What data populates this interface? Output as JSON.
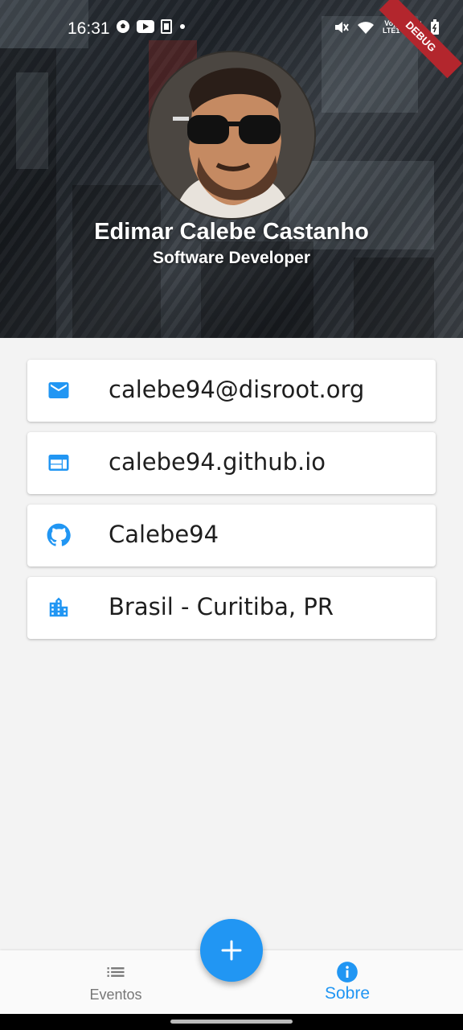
{
  "status_bar": {
    "time": "16:31",
    "left_icons": [
      "soccer-ball-icon",
      "youtube-icon",
      "sim-icon",
      "dot-icon"
    ],
    "right_icons": [
      "mute-icon",
      "wifi-icon",
      "volte-icon",
      "signal-icon",
      "battery-icon"
    ],
    "volte_label_top": "Vo))",
    "volte_label_bottom": "LTE1",
    "debug_banner": "DEBUG"
  },
  "profile": {
    "name": "Edimar Calebe Castanho",
    "role": "Software Developer"
  },
  "contacts": [
    {
      "icon": "email-icon",
      "label": "calebe94@disroot.org"
    },
    {
      "icon": "web-icon",
      "label": "calebe94.github.io"
    },
    {
      "icon": "github-icon",
      "label": "Calebe94"
    },
    {
      "icon": "location-city-icon",
      "label": "Brasil - Curitiba, PR"
    }
  ],
  "bottom_nav": {
    "items": [
      {
        "icon": "list-icon",
        "label": "Eventos",
        "active": false
      },
      {
        "icon": "info-icon",
        "label": "Sobre",
        "active": true
      }
    ]
  },
  "fab": {
    "icon": "plus-icon"
  },
  "colors": {
    "accent": "#2196f3",
    "background": "#f3f3f3",
    "card": "#ffffff",
    "debug": "#b3262d"
  }
}
